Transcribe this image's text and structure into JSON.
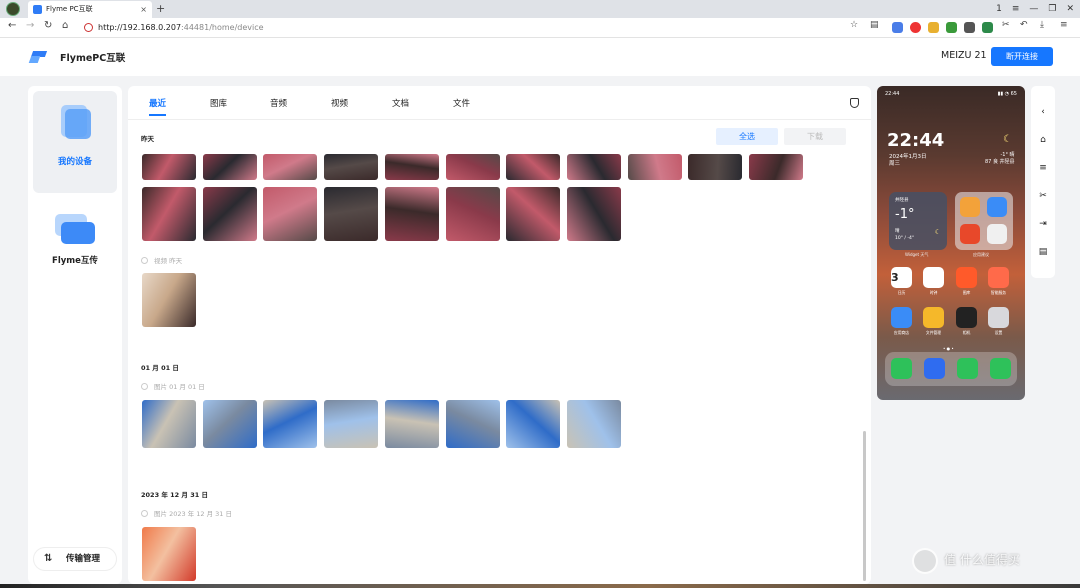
{
  "browser": {
    "tab_title": "Flyme PC互联",
    "tab_close": "×",
    "new_tab": "+",
    "url_host": "http://192.168.0.207",
    "url_path": ":44481/home/device",
    "window_controls": [
      "1",
      "≡",
      "—",
      "❐",
      "✕"
    ]
  },
  "header": {
    "app_title": "FlymePC互联",
    "device_name": "MEIZU 21",
    "disconnect_label": "断开连接"
  },
  "sidebar": {
    "items": [
      {
        "label": "我的设备",
        "icon": "device-icon",
        "active": true
      },
      {
        "label": "Flyme互传",
        "icon": "transfer-icon",
        "active": false
      }
    ],
    "transfer_manage": "传输管理"
  },
  "main": {
    "tabs": [
      "最近",
      "图库",
      "音频",
      "视频",
      "文档",
      "文件"
    ],
    "active_tab": "最近",
    "select_all": "全选",
    "download": "下载",
    "sections": [
      {
        "date": "昨天",
        "sub": "",
        "rows": [
          {
            "count": 11
          },
          {
            "count": 8
          }
        ]
      },
      {
        "date": "",
        "sub": "视频 昨天",
        "rows": [
          {
            "count": 1
          }
        ]
      },
      {
        "date": "01 月 01 日",
        "sub": "图片 01 月 01 日",
        "rows": [
          {
            "count": 8
          }
        ]
      },
      {
        "date": "2023 年 12 月 31 日",
        "sub": "图片 2023 年 12 月 31 日",
        "rows": [
          {
            "count": 1
          }
        ]
      }
    ]
  },
  "phone": {
    "status_time": "22:44",
    "clock": "22:44",
    "date_line": "2024年1月3日",
    "weekday": "周三",
    "weather_temp_small": "-1° 晴",
    "weather_aqi": "87 良 井陉县",
    "weather_card": {
      "place": "井陉县",
      "temp": "-1°",
      "cond": "晴",
      "range": "10° / -4°"
    },
    "widget_labels": [
      "Widget 天气",
      "应用建议"
    ],
    "apps": [
      {
        "label": "日历",
        "color": "#ffffff"
      },
      {
        "label": "时钟",
        "color": "#ffffff"
      },
      {
        "label": "图库",
        "color": "#ff5a2a"
      },
      {
        "label": "智能服务",
        "color": "#ff6a4a"
      },
      {
        "label": "应用商店",
        "color": "#3a8cf7"
      },
      {
        "label": "文件管理",
        "color": "#f5b82a"
      },
      {
        "label": "相机",
        "color": "#222222"
      },
      {
        "label": "设置",
        "color": "#d8d8dc"
      }
    ],
    "calendar_day": "3",
    "dock": [
      "#2ec15a",
      "#2f6cf0",
      "#2ec15a",
      "#2ec15a"
    ]
  },
  "toolbar_icons": [
    "back-icon",
    "home-icon",
    "menu-icon",
    "scissors-icon",
    "exit-icon",
    "clipboard-icon"
  ],
  "watermark": "值 什么值得买"
}
